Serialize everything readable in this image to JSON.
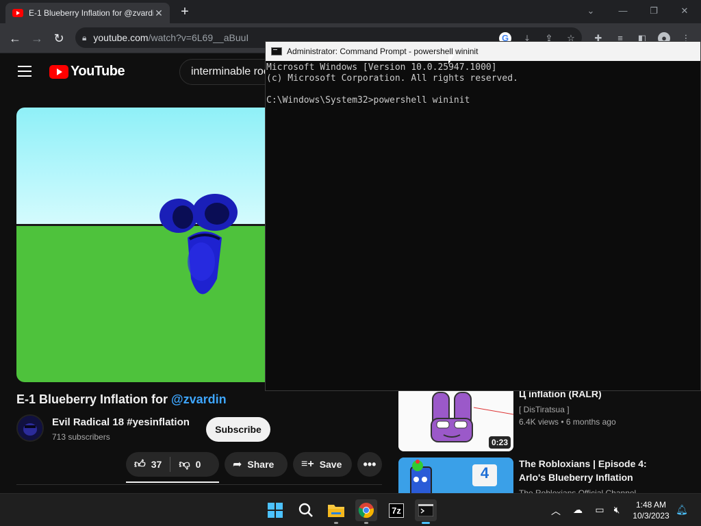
{
  "browser": {
    "tab_title": "E-1 Blueberry Inflation for @zvardin",
    "tab_close": "✕",
    "new_tab": "+",
    "url_host": "youtube.com",
    "url_path": "/watch?v=6L69__aBuuI",
    "window_buttons": [
      "⌄",
      "—",
      "❐",
      "✕"
    ]
  },
  "youtube": {
    "logo_text": "YouTube",
    "search_value": "interminable roo",
    "video_title": "E-1 Blueberry Inflation for ",
    "video_title_handle": "@zvardin",
    "channel_name": "Evil Radical 18 #yesinflation",
    "subscribers": "713 subscribers",
    "subscribe_label": "Subscribe",
    "likes": "37",
    "dislikes": "0",
    "share_label": "Share",
    "save_label": "Save",
    "more_label": "•••",
    "recommended": [
      {
        "title": "Ц inflation (RALR)",
        "channel": "[ DisTiratsua ]",
        "views": "6.4K views",
        "age": "6 months ago",
        "duration": "0:23"
      },
      {
        "title_line1": "The Robloxians | Episode 4:",
        "title_line2": "Arlo's Blueberry Inflation",
        "channel": "The Robloxians Official Channel",
        "badge": "4"
      }
    ]
  },
  "cmd": {
    "title": "Administrator: Command Prompt - powershell  wininit",
    "lines": [
      "Microsoft Windows [Version 10.0.25947.1000]",
      "(c) Microsoft Corporation. All rights reserved.",
      "",
      "C:\\Windows\\System32>powershell wininit"
    ]
  },
  "taskbar": {
    "time": "1:48 AM",
    "date": "10/3/2023",
    "apps": [
      "start-icon",
      "search-icon",
      "file-explorer-icon",
      "chrome-icon",
      "7zip-icon",
      "terminal-icon"
    ],
    "sevenzip_label": "7z"
  },
  "colors": {
    "youtube_red": "#ff0000",
    "link_blue": "#3ea6ff",
    "cmd_bg": "#0c0c0c",
    "taskbar_accent": "#4cc2ff"
  }
}
